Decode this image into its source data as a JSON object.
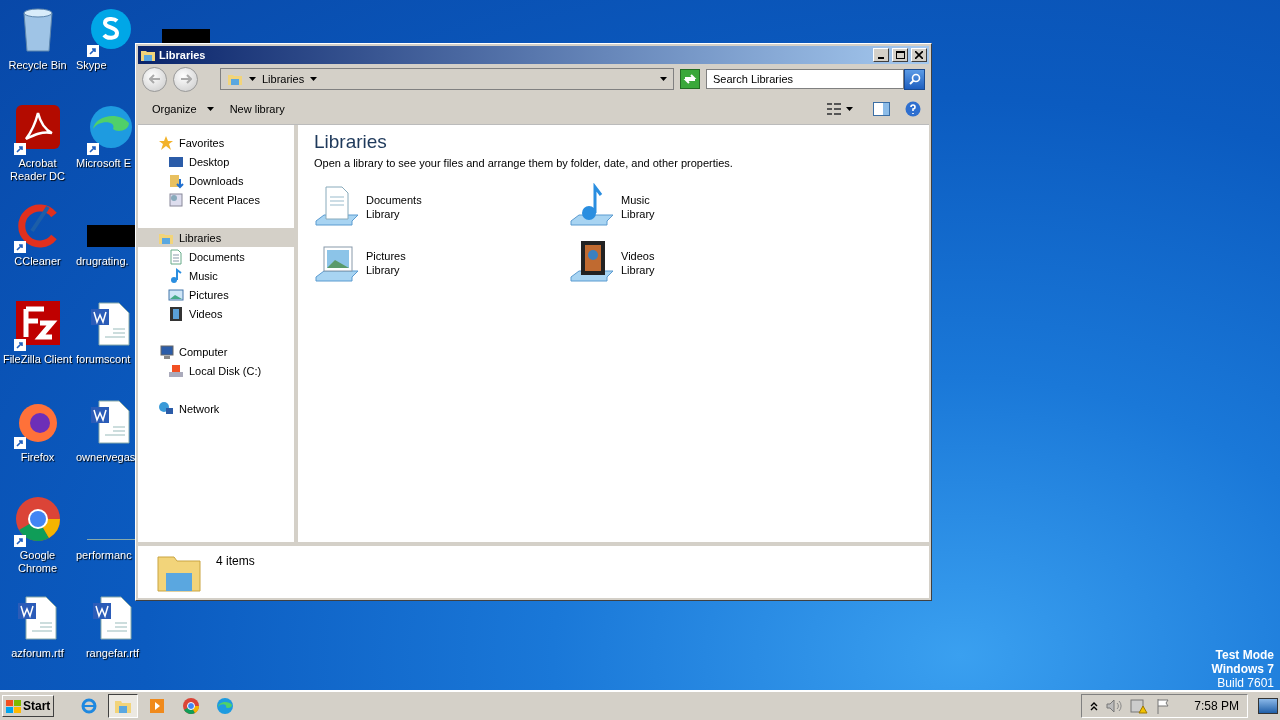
{
  "desktop": {
    "columns": [
      [
        {
          "label": "Recycle Bin",
          "kind": "recycle",
          "shortcut": false
        },
        {
          "label": "Acrobat Reader DC",
          "kind": "acrobat",
          "shortcut": true
        },
        {
          "label": "CCleaner",
          "kind": "ccleaner",
          "shortcut": true
        },
        {
          "label": "FileZilla Client",
          "kind": "filezilla",
          "shortcut": true
        },
        {
          "label": "Firefox",
          "kind": "firefox",
          "shortcut": true
        },
        {
          "label": "Google Chrome",
          "kind": "chrome",
          "shortcut": true
        },
        {
          "label": "azforum.rtf",
          "kind": "word",
          "shortcut": false
        }
      ],
      [
        {
          "label": "Skype",
          "kind": "skype",
          "shortcut": true
        },
        {
          "label": "Microsoft E",
          "kind": "edge",
          "shortcut": true
        },
        {
          "label": "drugrating.",
          "kind": "redacted",
          "shortcut": false
        },
        {
          "label": "forumscont",
          "kind": "word",
          "shortcut": false
        },
        {
          "label": "ownervegas",
          "kind": "word",
          "shortcut": false
        },
        {
          "label": "performanc",
          "kind": "blank",
          "shortcut": false
        },
        {
          "label": "rangefar.rtf",
          "kind": "word",
          "shortcut": false
        }
      ],
      [
        {
          "kind": "redacted",
          "shortcut": false
        }
      ]
    ],
    "system_text": [
      "Test Mode",
      "Windows 7",
      "Build 7601"
    ]
  },
  "window": {
    "title": "Libraries",
    "address": {
      "crumbs": [
        "Libraries"
      ]
    },
    "search": {
      "placeholder": "Search Libraries"
    },
    "toolbar": [
      {
        "label": "Organize",
        "dropdown": true
      },
      {
        "label": "New library",
        "dropdown": false
      }
    ],
    "nav": [
      {
        "label": "Favorites",
        "kind": "star",
        "selected": false,
        "children": [
          {
            "label": "Desktop",
            "kind": "desktop",
            "selected": false
          },
          {
            "label": "Downloads",
            "kind": "downloads",
            "selected": false
          },
          {
            "label": "Recent Places",
            "kind": "recent",
            "selected": false
          }
        ]
      },
      {
        "label": "Libraries",
        "kind": "libraries",
        "selected": true,
        "children": [
          {
            "label": "Documents",
            "kind": "documents",
            "selected": false
          },
          {
            "label": "Music",
            "kind": "music",
            "selected": false
          },
          {
            "label": "Pictures",
            "kind": "pictures",
            "selected": false
          },
          {
            "label": "Videos",
            "kind": "videos",
            "selected": false
          }
        ]
      },
      {
        "label": "Computer",
        "kind": "computer",
        "selected": false,
        "children": [
          {
            "label": "Local Disk (C:)",
            "kind": "disk",
            "selected": false
          }
        ]
      },
      {
        "label": "Network",
        "kind": "network",
        "selected": false
      }
    ],
    "content": {
      "heading": "Libraries",
      "description": "Open a library to see your files and arrange them by folder, date, and other properties.",
      "libraries": [
        {
          "name": "Documents",
          "subtitle": "Library",
          "kind": "documents"
        },
        {
          "name": "Music",
          "subtitle": "Library",
          "kind": "music"
        },
        {
          "name": "Pictures",
          "subtitle": "Library",
          "kind": "pictures"
        },
        {
          "name": "Videos",
          "subtitle": "Library",
          "kind": "videos"
        }
      ]
    },
    "status": "4 items"
  },
  "taskbar": {
    "start": "Start",
    "apps": [
      {
        "kind": "ie",
        "active": false
      },
      {
        "kind": "explorer",
        "active": true
      },
      {
        "kind": "media",
        "active": false
      },
      {
        "kind": "chrome",
        "active": false
      },
      {
        "kind": "edge",
        "active": false
      }
    ],
    "time": "7:58 PM"
  }
}
